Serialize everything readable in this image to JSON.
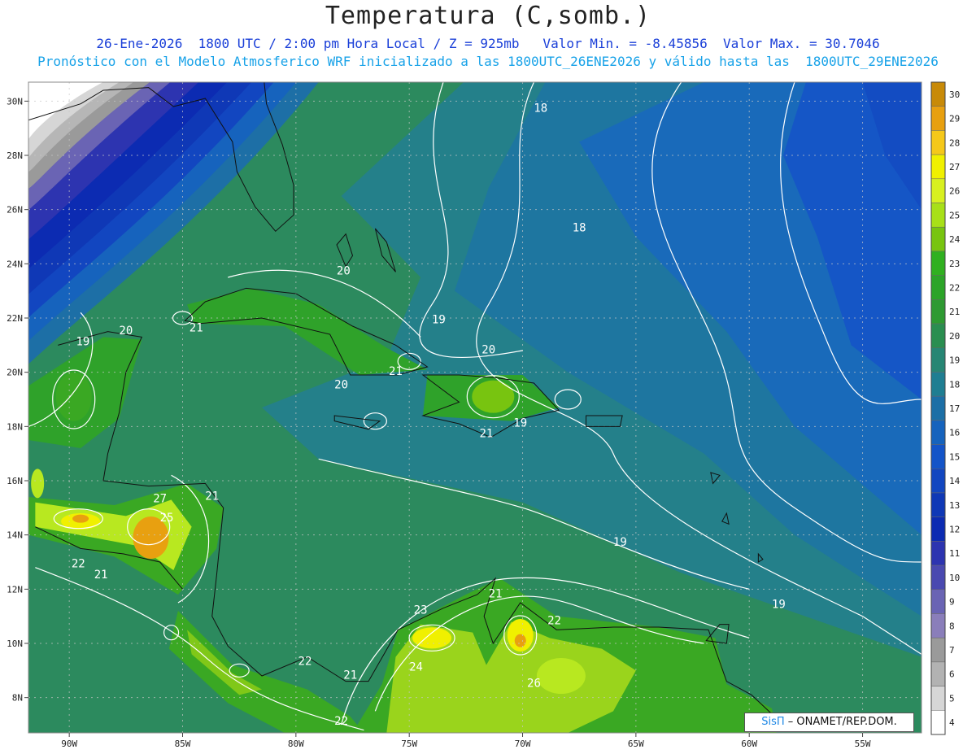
{
  "header": {
    "title": "Temperatura (C,somb.)",
    "subtitle": "26-Ene-2026  1800 UTC / 2:00 pm Hora Local / Z = 925mb   Valor Min. = -8.45856  Valor Max. = 30.7046",
    "description": "Pronóstico con el Modelo Atmosferico WRF inicializado a las 1800UTC_26ENE2026 y válido hasta las  1800UTC_29ENE2026"
  },
  "credit": {
    "brand": "SisΠ",
    "org": "– ONAMET/REP.DOM."
  },
  "map": {
    "lat_labels": [
      "30N",
      "28N",
      "26N",
      "24N",
      "22N",
      "20N",
      "18N",
      "16N",
      "14N",
      "12N",
      "10N",
      "8N"
    ],
    "lat_values": [
      30,
      28,
      26,
      24,
      22,
      20,
      18,
      16,
      14,
      12,
      10,
      8
    ],
    "lon_labels": [
      "90W",
      "85W",
      "80W",
      "75W",
      "70W",
      "65W",
      "60W",
      "55W"
    ],
    "lon_values": [
      -90,
      -85,
      -80,
      -75,
      -70,
      -65,
      -60,
      -55
    ],
    "contour_labels": [
      {
        "text": "18",
        "lon": -69.2,
        "lat": 29.6
      },
      {
        "text": "18",
        "lon": -67.5,
        "lat": 25.2
      },
      {
        "text": "20",
        "lon": -77.9,
        "lat": 23.6
      },
      {
        "text": "19",
        "lon": -73.7,
        "lat": 21.8
      },
      {
        "text": "20",
        "lon": -71.5,
        "lat": 20.7
      },
      {
        "text": "20",
        "lon": -87.5,
        "lat": 21.4
      },
      {
        "text": "21",
        "lon": -84.4,
        "lat": 21.5
      },
      {
        "text": "19",
        "lon": -89.4,
        "lat": 21.0
      },
      {
        "text": "21",
        "lon": -75.6,
        "lat": 19.9
      },
      {
        "text": "20",
        "lon": -78.0,
        "lat": 19.4
      },
      {
        "text": "19",
        "lon": -70.1,
        "lat": 18.0
      },
      {
        "text": "21",
        "lon": -71.6,
        "lat": 17.6
      },
      {
        "text": "21",
        "lon": -83.7,
        "lat": 15.3
      },
      {
        "text": "27",
        "lon": -86.0,
        "lat": 15.2
      },
      {
        "text": "25",
        "lon": -85.7,
        "lat": 14.5
      },
      {
        "text": "19",
        "lon": -65.7,
        "lat": 13.6
      },
      {
        "text": "22",
        "lon": -89.6,
        "lat": 12.8
      },
      {
        "text": "21",
        "lon": -88.6,
        "lat": 12.4
      },
      {
        "text": "21",
        "lon": -71.2,
        "lat": 11.7
      },
      {
        "text": "23",
        "lon": -74.5,
        "lat": 11.1
      },
      {
        "text": "22",
        "lon": -68.6,
        "lat": 10.7
      },
      {
        "text": "19",
        "lon": -58.7,
        "lat": 11.3
      },
      {
        "text": "22",
        "lon": -79.6,
        "lat": 9.2
      },
      {
        "text": "24",
        "lon": -74.7,
        "lat": 9.0
      },
      {
        "text": "21",
        "lon": -77.6,
        "lat": 8.7
      },
      {
        "text": "26",
        "lon": -69.5,
        "lat": 8.4
      },
      {
        "text": "22",
        "lon": -78.0,
        "lat": 7.0
      }
    ]
  },
  "colorbar": {
    "levels": [
      30,
      29,
      28,
      27,
      26,
      25,
      24,
      23,
      22,
      21,
      20,
      19,
      18,
      17,
      16,
      15,
      14,
      13,
      12,
      11,
      10,
      9,
      8,
      7,
      6,
      5,
      4
    ],
    "colors": [
      "#c88a08",
      "#e8a010",
      "#f5c81a",
      "#f0f000",
      "#d8f020",
      "#a8e018",
      "#78c410",
      "#30b020",
      "#2ca428",
      "#2e9a32",
      "#2a8e50",
      "#278674",
      "#1f7e92",
      "#1c6fa6",
      "#1663bd",
      "#1454c8",
      "#1246c0",
      "#0f38b6",
      "#0c2bb2",
      "#2d34b0",
      "#4a49b0",
      "#6a64b4",
      "#8a7eba",
      "#9a9a9a",
      "#b2b2b2",
      "#d6d6d6",
      "#ffffff"
    ]
  }
}
